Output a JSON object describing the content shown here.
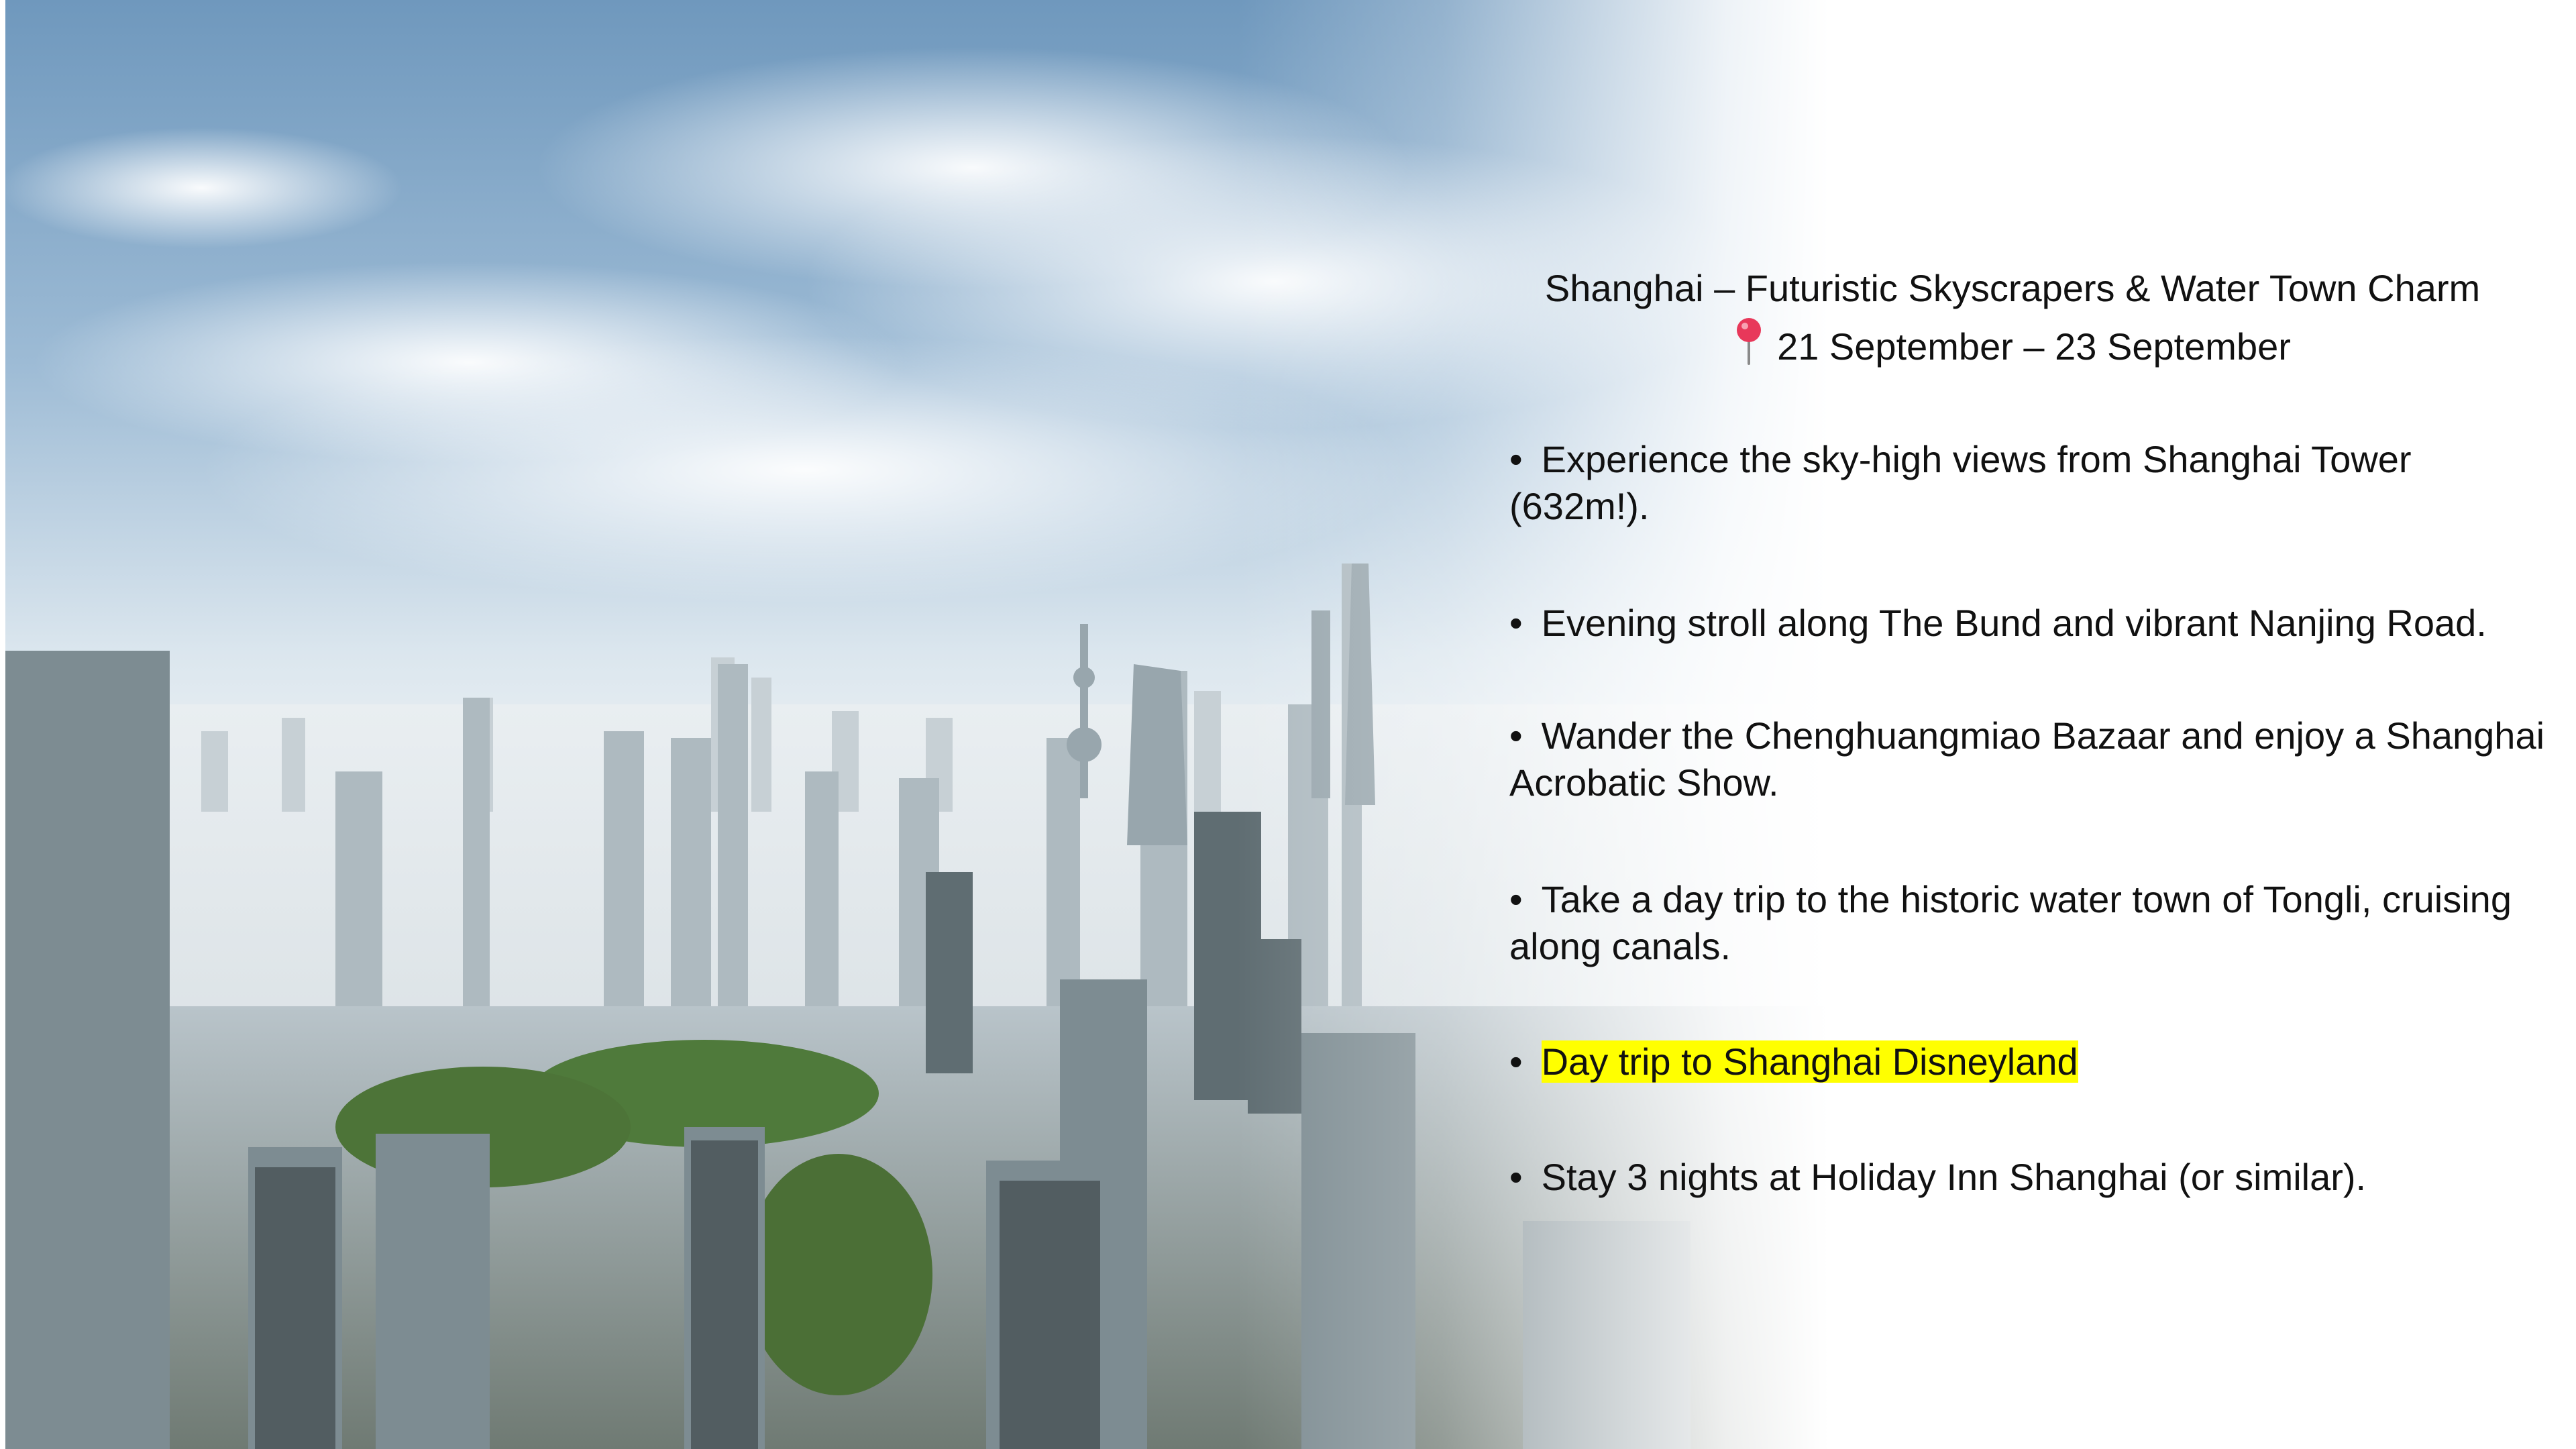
{
  "slide": {
    "title": "Shanghai – Futuristic Skyscrapers & Water Town Charm",
    "dates": "21 September – 23 September",
    "pin_icon": "round-pushpin-icon",
    "bullet_char": "•",
    "bullets": [
      {
        "text": "Experience the sky-high views from Shanghai Tower (632m!).",
        "highlighted": false
      },
      {
        "text": "Evening stroll along The Bund and vibrant Nanjing Road.",
        "highlighted": false
      },
      {
        "text": "Wander the Chenghuangmiao Bazaar and enjoy a Shanghai Acrobatic Show.",
        "highlighted": false
      },
      {
        "text": "Take a day trip to the historic water town of Tongli, cruising along canals.",
        "highlighted": false
      },
      {
        "text": "Day trip to Shanghai Disneyland",
        "highlighted": true
      },
      {
        "text": "Stay 3 nights at Holiday Inn Shanghai (or similar).",
        "highlighted": false
      }
    ],
    "colors": {
      "text": "#111111",
      "highlight": "#ffff00",
      "pin": "#e8385a"
    }
  }
}
